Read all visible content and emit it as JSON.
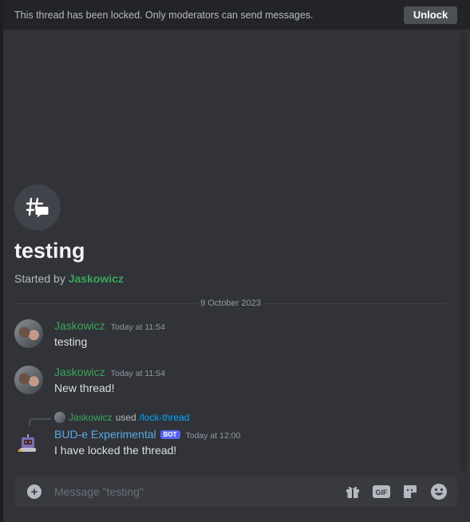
{
  "lock_banner": {
    "text": "This thread has been locked. Only moderators can send messages.",
    "unlock_label": "Unlock"
  },
  "thread": {
    "icon": "thread-icon",
    "title": "testing",
    "started_by_prefix": "Started by",
    "started_by_user": "Jaskowicz"
  },
  "divider_date": "9 October 2023",
  "messages": [
    {
      "author": "Jaskowicz",
      "timestamp": "Today at 11:54",
      "text": "testing"
    },
    {
      "author": "Jaskowicz",
      "timestamp": "Today at 11:54",
      "text": "New thread!"
    }
  ],
  "bot_message": {
    "reply_user": "Jaskowicz",
    "reply_used": "used",
    "reply_command": "/lock-thread",
    "author": "BUD-e Experimental",
    "badge": "BOT",
    "timestamp": "Today at 12:00",
    "text": "I have locked the thread!"
  },
  "composer": {
    "placeholder": "Message \"testing\"",
    "icons": [
      "add-icon",
      "gift-icon",
      "gif-icon",
      "sticker-icon",
      "emoji-icon"
    ]
  },
  "colors": {
    "background": "#313338",
    "username_green": "#3ba55c",
    "bot_name": "#5aa9e6",
    "bot_badge": "#5865f2",
    "command_link": "#00a8fc"
  }
}
